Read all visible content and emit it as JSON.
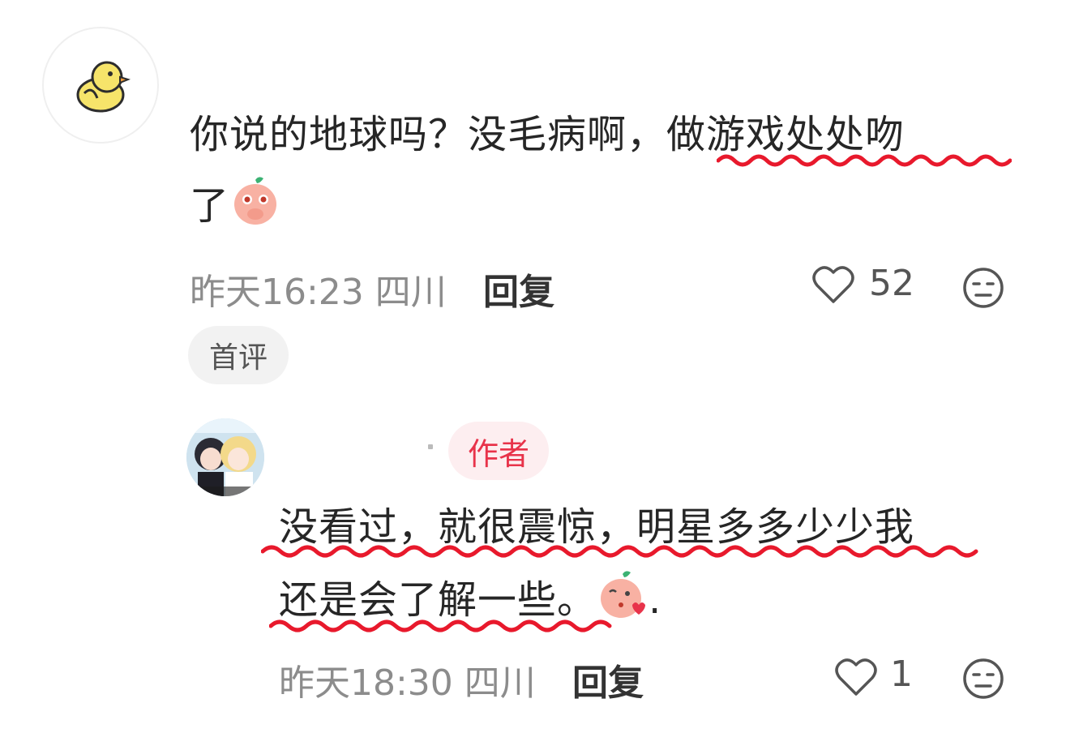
{
  "comments": [
    {
      "text_before": "你说的地球吗？没毛病啊，",
      "text_highlight": "做游戏处处吻",
      "text_line2": "了",
      "time": "昨天16:23 四川",
      "reply_label": "回复",
      "likes": "52",
      "badge": "首评",
      "avatar": "duck-avatar",
      "emoji": "peach-cover-mouth-emoji"
    },
    {
      "badge": "作者",
      "line1": "没看过，就很震惊，明星多多少少我",
      "line2_highlight": "还是会了解一些。",
      "line2_tail": ".",
      "time": "昨天18:30 四川",
      "reply_label": "回复",
      "likes": "1",
      "avatar": "anime-couple-avatar",
      "emoji": "peach-kiss-emoji"
    }
  ],
  "colors": {
    "underline": "#e8192c",
    "author_badge_text": "#e8334a",
    "author_badge_bg": "#fdeef0",
    "meta_text": "#8c8c8c"
  },
  "icons": [
    "heart-outline-icon",
    "dislike-face-icon"
  ]
}
